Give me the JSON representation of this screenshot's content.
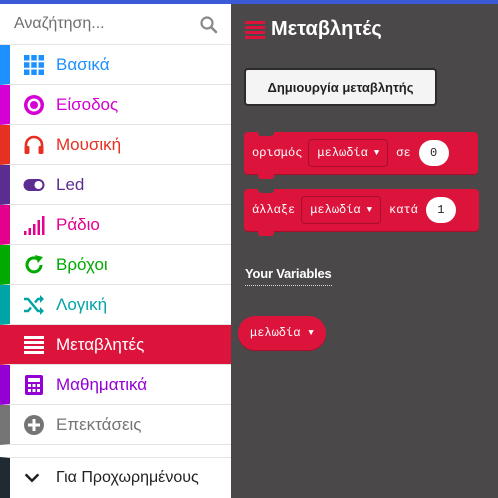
{
  "search": {
    "placeholder": "Αναζήτηση..."
  },
  "categories": [
    {
      "label": "Βασικά",
      "color": "#1e90ff",
      "icon": "grid-icon"
    },
    {
      "label": "Είσοδος",
      "color": "#d400d4",
      "icon": "target-icon"
    },
    {
      "label": "Μουσική",
      "color": "#e63022",
      "icon": "headphones-icon"
    },
    {
      "label": "Led",
      "color": "#5c2d91",
      "icon": "toggle-icon"
    },
    {
      "label": "Ράδιο",
      "color": "#e3008c",
      "icon": "signal-icon"
    },
    {
      "label": "Βρόχοι",
      "color": "#00aa00",
      "icon": "refresh-icon"
    },
    {
      "label": "Λογική",
      "color": "#00a4a6",
      "icon": "shuffle-icon"
    },
    {
      "label": "Μεταβλητές",
      "color": "#dc143c",
      "icon": "list-icon",
      "active": true
    },
    {
      "label": "Μαθηματικά",
      "color": "#9400d3",
      "icon": "calculator-icon"
    },
    {
      "label": "Επεκτάσεις",
      "color": "#757575",
      "icon": "plus-circle-icon"
    }
  ],
  "advanced": {
    "label": "Για Προχωρημένους",
    "color": "#1f2a33",
    "icon": "chevron-down-icon"
  },
  "flyout": {
    "title": "Μεταβλητές",
    "create_button": "Δημιουργία μεταβλητής",
    "set_block": {
      "keyword": "ορισμός",
      "variable": "μελωδία",
      "connector": "σε",
      "value": "0"
    },
    "change_block": {
      "keyword": "άλλαξε",
      "variable": "μελωδία",
      "connector": "κατά",
      "value": "1"
    },
    "section_label": "Your Variables",
    "variable_pill": "μελωδία"
  },
  "colors": {
    "accent": "#dc143c",
    "flyout_bg": "#4a4848",
    "top_bar": "#3b5bd6"
  }
}
